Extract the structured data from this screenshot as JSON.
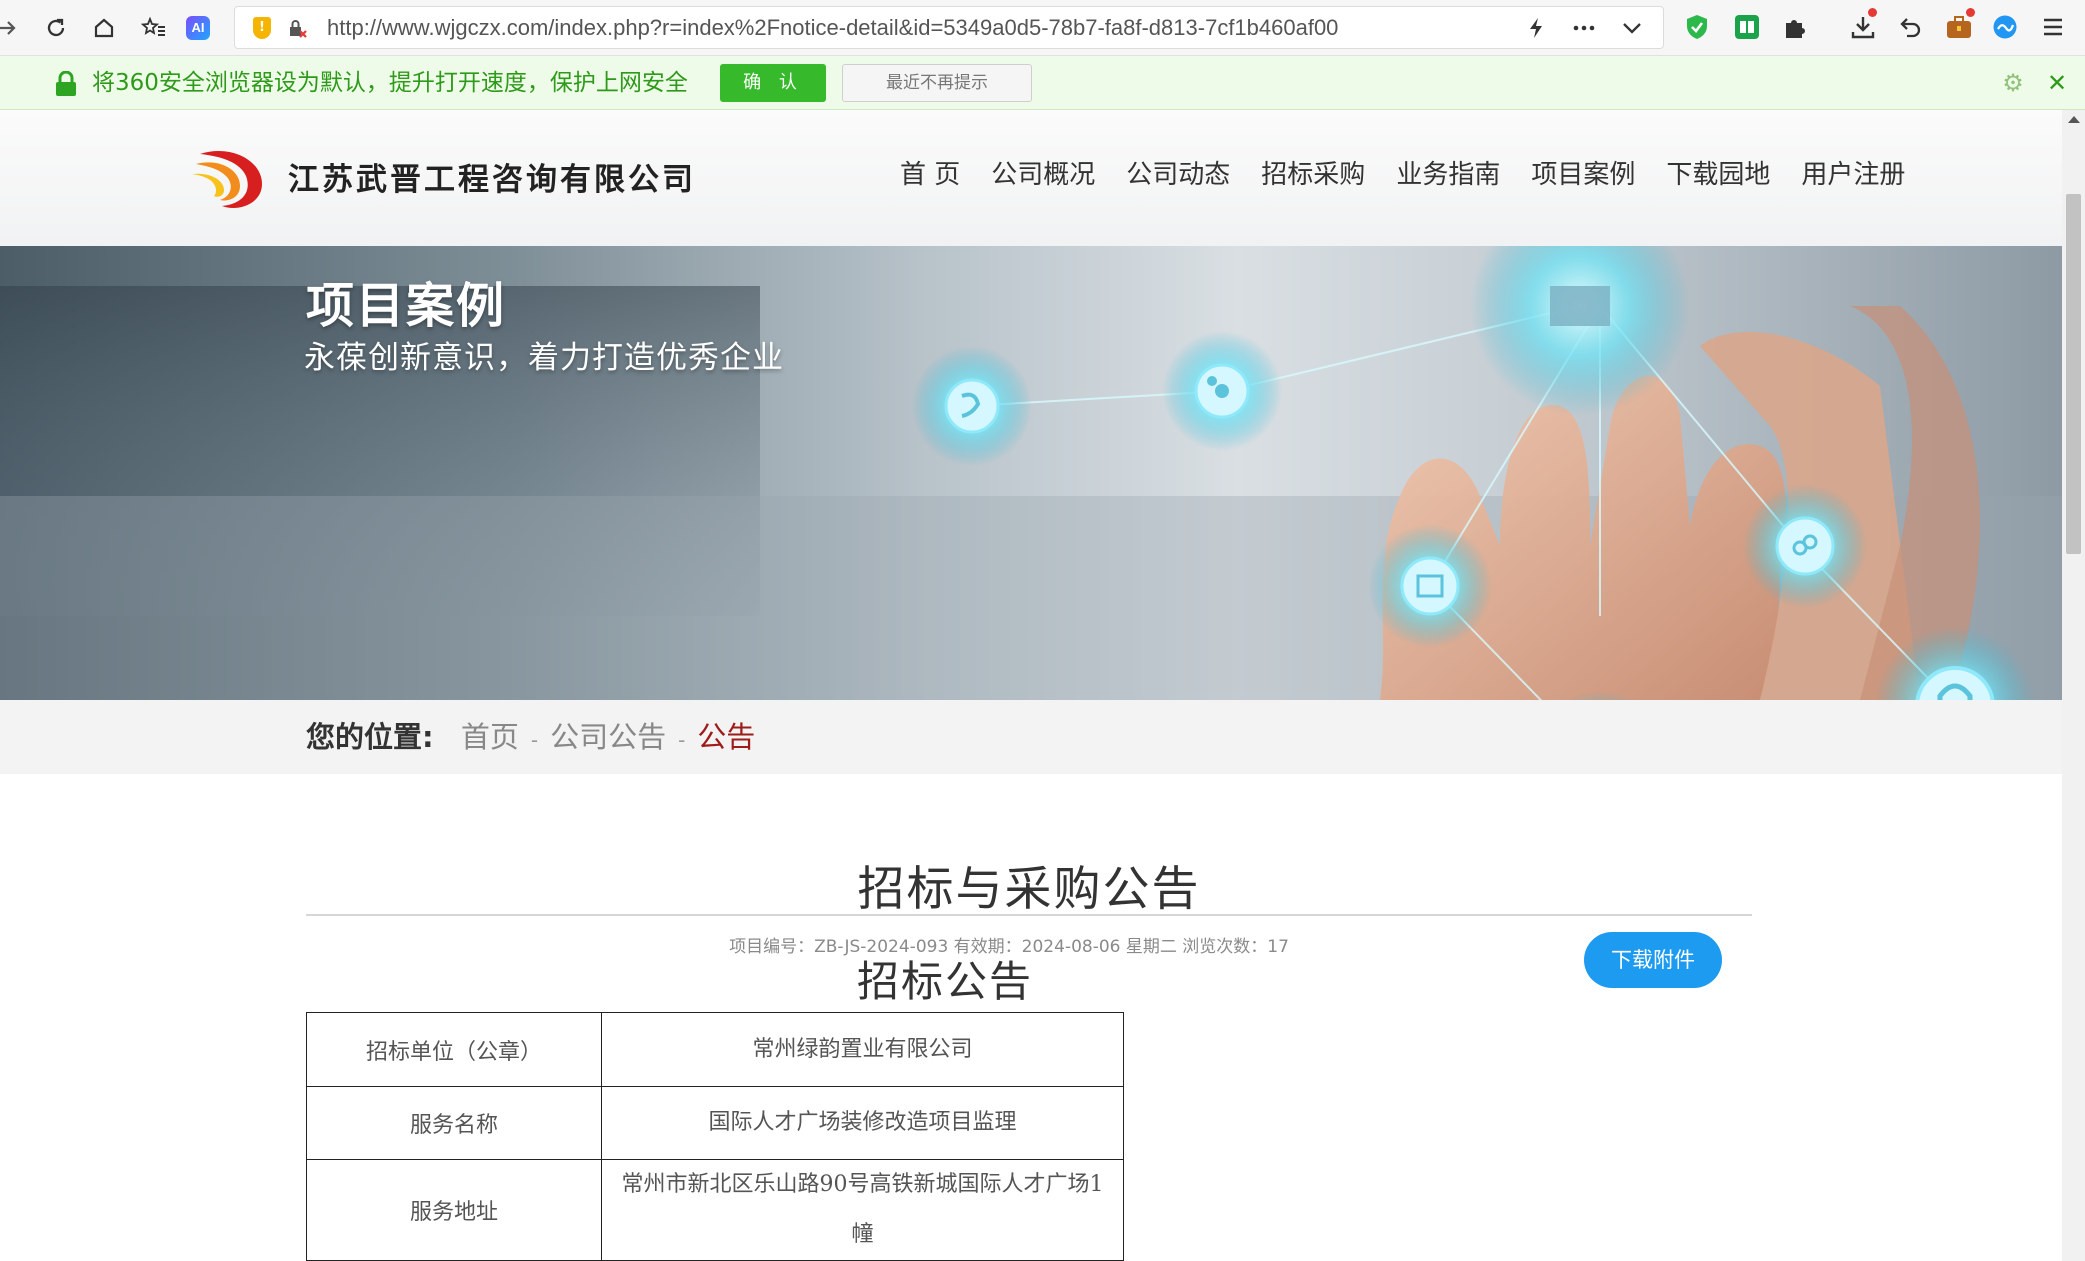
{
  "browser": {
    "url": "http://www.wjgczx.com/index.php?r=index%2Fnotice-detail&id=5349a0d5-78b7-fa8f-d813-7cf1b460af00",
    "notice_text": "将360安全浏览器设为默认，提升打开速度，保护上网安全",
    "confirm_label": "确 认",
    "dismiss_label": "最近不再提示"
  },
  "site": {
    "company_name": "江苏武晋工程咨询有限公司",
    "nav": [
      "首 页",
      "公司概况",
      "公司动态",
      "招标采购",
      "业务指南",
      "项目案例",
      "下载园地",
      "用户注册"
    ]
  },
  "banner": {
    "title": "项目案例",
    "subtitle": "永葆创新意识，着力打造优秀企业"
  },
  "breadcrumb": {
    "label": "您的位置:",
    "items": [
      "首页",
      "公司公告",
      "公告"
    ],
    "separator": "-"
  },
  "article": {
    "title": "招标与采购公告",
    "meta": "项目编号：ZB-JS-2024-093 有效期：2024-08-06 星期二 浏览次数：17",
    "download_label": "下载附件",
    "doc_heading": "招标公告",
    "table": [
      {
        "key": "招标单位（公章）",
        "value": "常州绿韵置业有限公司"
      },
      {
        "key": "服务名称",
        "value": "国际人才广场装修改造项目监理"
      },
      {
        "key": "服务地址",
        "value": "常州市新北区乐山路90号高铁新城国际人才广场1幢"
      }
    ]
  },
  "colors": {
    "nav_text": "#333333",
    "breadcrumb_current": "#9e1b1b",
    "download_button": "#1d9bf0",
    "notice_green": "#2e9a1a",
    "confirm_button": "#36b92a"
  },
  "icons": {
    "toolbar": [
      "back-icon",
      "reload-icon",
      "home-icon",
      "favorites-icon",
      "ai-icon"
    ],
    "address": [
      "shield-warning-icon",
      "insecure-lock-icon",
      "lightning-icon",
      "more-icon",
      "chevron-down-icon"
    ],
    "extensions": [
      "security-shield-icon",
      "reader-icon",
      "extensions-icon",
      "download-icon",
      "undo-icon",
      "toolbox-icon",
      "translate-icon",
      "menu-icon"
    ]
  }
}
